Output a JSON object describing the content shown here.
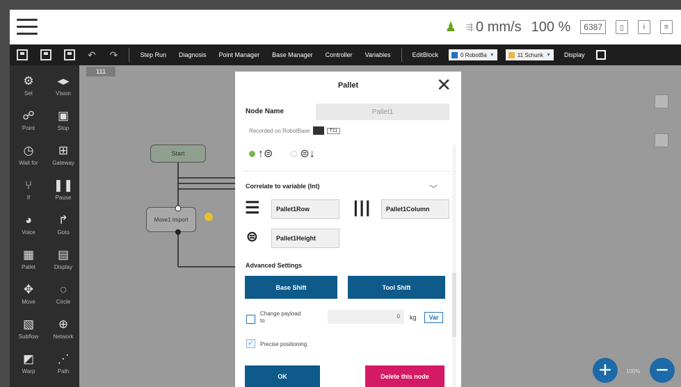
{
  "status": {
    "speed": "0 mm/s",
    "percent": "100 %",
    "ip": "6387"
  },
  "toolbar": {
    "items": [
      "Step Run",
      "Diagnosis",
      "Point Manager",
      "Base Manager",
      "Controller",
      "Variables",
      "EditBlock"
    ],
    "base_select": "0 RobotBa",
    "tool_select": "11 Schunk",
    "display": "Display"
  },
  "palette": [
    {
      "label": "Set",
      "icon": "wrench-icon",
      "glyph": "⚙"
    },
    {
      "label": "Vision",
      "icon": "vision-icon",
      "glyph": "◂▸"
    },
    {
      "label": "Point",
      "icon": "point-icon",
      "glyph": "☍"
    },
    {
      "label": "Stop",
      "icon": "stop-icon",
      "glyph": "▣"
    },
    {
      "label": "Wait for",
      "icon": "wait-icon",
      "glyph": "◷"
    },
    {
      "label": "Gateway",
      "icon": "gateway-icon",
      "glyph": "⊞"
    },
    {
      "label": "If",
      "icon": "if-icon",
      "glyph": "⑂"
    },
    {
      "label": "Pause",
      "icon": "pause-icon",
      "glyph": "❚❚"
    },
    {
      "label": "Voice",
      "icon": "voice-icon",
      "glyph": "◕"
    },
    {
      "label": "Goto",
      "icon": "goto-icon",
      "glyph": "↱"
    },
    {
      "label": "Pallet",
      "icon": "pallet-icon",
      "glyph": "▦"
    },
    {
      "label": "Display",
      "icon": "display-icon",
      "glyph": "▤"
    },
    {
      "label": "Move",
      "icon": "move-icon",
      "glyph": "✥"
    },
    {
      "label": "Circle",
      "icon": "circle-icon",
      "glyph": "◌"
    },
    {
      "label": "Subflow",
      "icon": "subflow-icon",
      "glyph": "▧"
    },
    {
      "label": "Network",
      "icon": "network-icon",
      "glyph": "⊕"
    },
    {
      "label": "Warp",
      "icon": "warp-icon",
      "glyph": "◩"
    },
    {
      "label": "Path",
      "icon": "path-icon",
      "glyph": "⋰"
    }
  ],
  "canvas": {
    "tab": "111",
    "start_node": "Start",
    "node2": "Move1 Import",
    "zoom_label": "100%"
  },
  "dialog": {
    "title": "Pallet",
    "node_name_label": "Node Name",
    "node_name_value": "Pallet1",
    "recorded_on": "Recorded on RobotBase",
    "recorded_badge": "T11",
    "correlate_label": "Correlate to variable (Int)",
    "row_var": "Pallet1Row",
    "column_var": "Pallet1Column",
    "height_var": "Pallet1Height",
    "advanced_label": "Advanced Settings",
    "base_shift": "Base Shift",
    "tool_shift": "Tool Shift",
    "change_payload": "Change payload to",
    "payload_value": "0",
    "payload_unit": "kg",
    "var_button": "Var",
    "precise_positioning": "Precise positioning",
    "ok": "OK",
    "delete": "Delete this node"
  }
}
